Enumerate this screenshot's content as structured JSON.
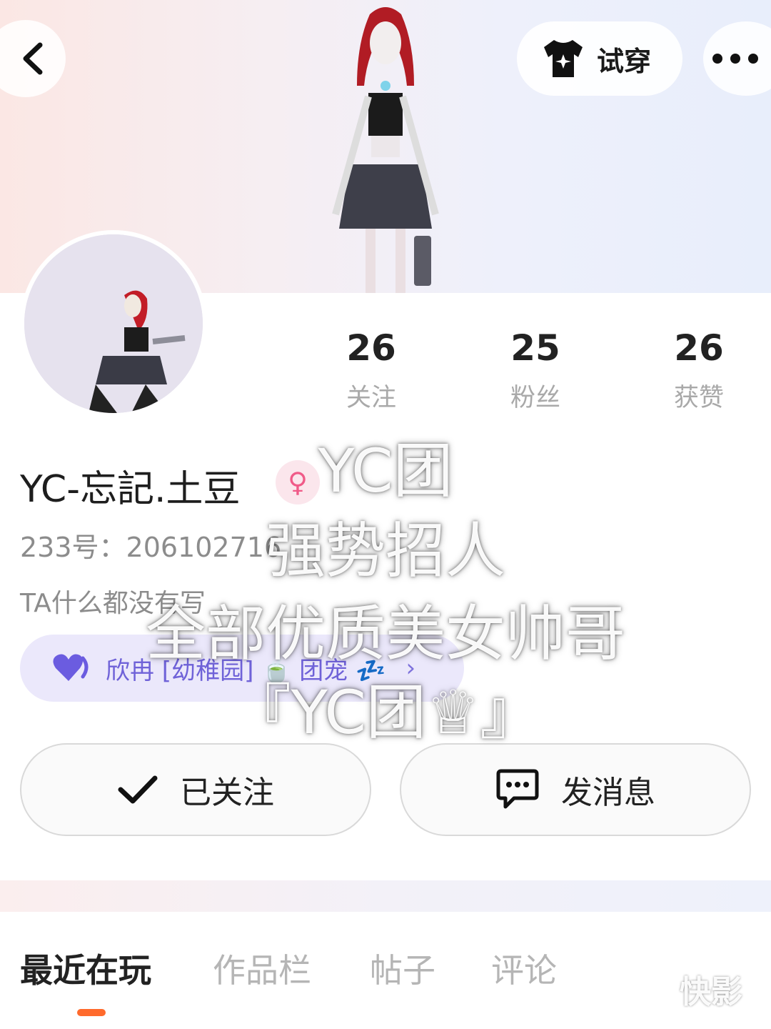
{
  "header": {
    "try_on_label": "试穿"
  },
  "stats": [
    {
      "value": "26",
      "label": "关注"
    },
    {
      "value": "25",
      "label": "粉丝"
    },
    {
      "value": "26",
      "label": "获赞"
    }
  ],
  "profile": {
    "username": "YC-忘記.土豆",
    "user_id": "233号：206102716",
    "bio": "TA什么都没有写",
    "guild": "欣冉 [幼稚园] 🍵 团宠 💤"
  },
  "actions": {
    "follow_label": "已关注",
    "message_label": "发消息"
  },
  "tabs": [
    "最近在玩",
    "作品栏",
    "帖子",
    "评论"
  ],
  "overlay_text": [
    "YC团",
    "强势招人",
    "全部优质美女帅哥",
    "『YC团♕』"
  ],
  "watermark": "快影",
  "colors": {
    "accent": "#ff6a2c",
    "guild_text": "#6f62d8",
    "gender": "#f05a88"
  }
}
